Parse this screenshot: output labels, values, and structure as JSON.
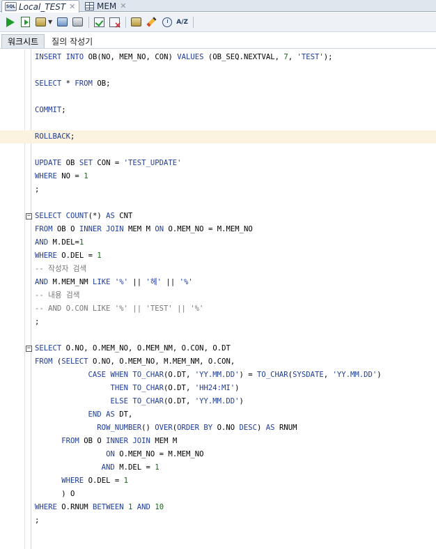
{
  "window_tabs": [
    {
      "label": "Local_TEST",
      "icon": "sql-worksheet-icon",
      "active": true
    },
    {
      "label": "MEM",
      "icon": "table-grid-icon",
      "active": false
    }
  ],
  "toolbar": {
    "buttons": [
      "run-statement",
      "run-script",
      "autotrace",
      "explain-plan",
      "sql-tuning",
      "commit",
      "rollback",
      "unshared-worksheet",
      "clear",
      "sql-history",
      "format"
    ],
    "format_label": "A/Z"
  },
  "sub_tabs": [
    {
      "label": "워크시트",
      "active": true
    },
    {
      "label": "질의 작성기",
      "active": false
    }
  ],
  "editor": {
    "current_line_index": 6,
    "lines": [
      "INSERT INTO OB(NO, MEM_NO, CON) VALUES (OB_SEQ.NEXTVAL, 7, 'TEST');",
      "",
      "SELECT * FROM OB;",
      "",
      "COMMIT;",
      "",
      "ROLLBACK;",
      "",
      "UPDATE OB SET CON = 'TEST_UPDATE'",
      "WHERE NO = 1",
      ";",
      "",
      "SELECT COUNT(*) AS CNT",
      "FROM OB O INNER JOIN MEM M ON O.MEM_NO = M.MEM_NO",
      "AND M.DEL=1",
      "WHERE O.DEL = 1",
      "-- 작성자 검색",
      "AND M.MEM_NM LIKE '%' || '헤' || '%'",
      "-- 내용 검색",
      "-- AND O.CON LIKE '%' || 'TEST' || '%'",
      ";",
      "",
      "SELECT O.NO, O.MEM_NO, O.MEM_NM, O.CON, O.DT",
      "FROM (SELECT O.NO, O.MEM_NO, M.MEM_NM, O.CON,",
      "            CASE WHEN TO_CHAR(O.DT, 'YY.MM.DD') = TO_CHAR(SYSDATE, 'YY.MM.DD')",
      "                 THEN TO_CHAR(O.DT, 'HH24:MI')",
      "                 ELSE TO_CHAR(O.DT, 'YY.MM.DD')",
      "            END AS DT,",
      "              ROW_NUMBER() OVER(ORDER BY O.NO DESC) AS RNUM",
      "      FROM OB O INNER JOIN MEM M",
      "                ON O.MEM_NO = M.MEM_NO",
      "               AND M.DEL = 1",
      "      WHERE O.DEL = 1",
      "      ) O",
      "WHERE O.RNUM BETWEEN 1 AND 10",
      ";"
    ],
    "fold_markers_at": [
      12,
      22
    ]
  }
}
